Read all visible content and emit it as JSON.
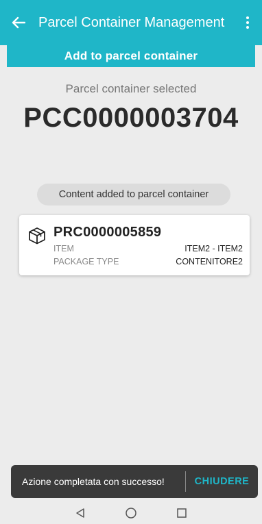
{
  "appbar": {
    "title": "Parcel Container Management",
    "back_icon": "arrow-left-icon",
    "menu_icon": "more-vertical-icon"
  },
  "subbar": {
    "title": "Add to parcel container"
  },
  "selection": {
    "label": "Parcel container selected",
    "code": "PCC0000003704"
  },
  "chip": {
    "label": "Content added to parcel container"
  },
  "card": {
    "icon": "package-box-icon",
    "code": "PRC0000005859",
    "rows": [
      {
        "key": "ITEM",
        "value": "ITEM2 - ITEM2"
      },
      {
        "key": "PACKAGE TYPE",
        "value": "CONTENITORE2"
      }
    ]
  },
  "snackbar": {
    "message": "Azione completata con successo!",
    "action": "CHIUDERE"
  },
  "navbar": {
    "back_icon": "nav-back-triangle-icon",
    "home_icon": "nav-home-circle-icon",
    "recents_icon": "nav-recents-square-icon"
  },
  "colors": {
    "accent": "#1fb6c8",
    "background": "#ececec",
    "snackbar": "#3a3a3a"
  }
}
